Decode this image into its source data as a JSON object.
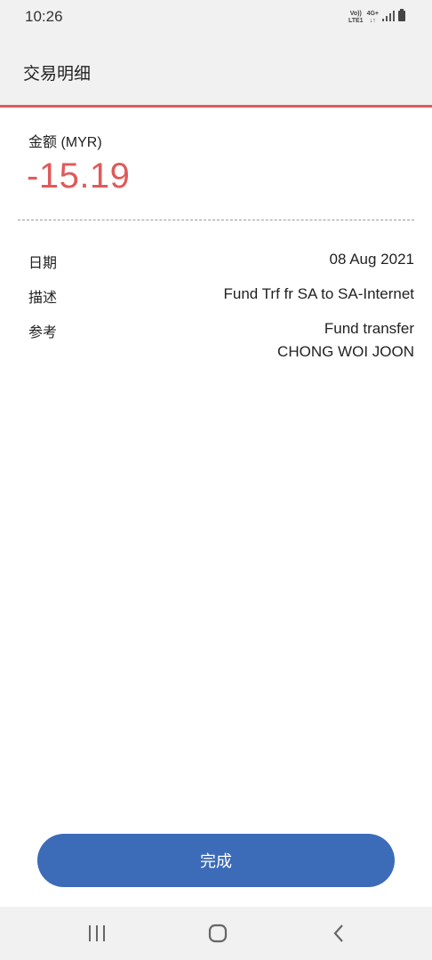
{
  "status_bar": {
    "time": "10:26",
    "volte_label_top": "Vo))",
    "volte_label_bottom": "LTE1",
    "network_label": "4G+"
  },
  "header": {
    "title": "交易明细"
  },
  "amount": {
    "label": "金额 (MYR)",
    "value": "-15.19",
    "color": "#e05a5a"
  },
  "details": {
    "date_label": "日期",
    "date_value": "08 Aug 2021",
    "description_label": "描述",
    "description_value": "Fund Trf fr SA to SA-Internet",
    "reference_label": "参考",
    "reference_line1": "Fund transfer",
    "reference_line2": "CHONG WOI JOON"
  },
  "done_button": {
    "label": "完成",
    "color": "#3c6bb8"
  },
  "nav": {
    "icons": [
      "recent-apps-icon",
      "home-icon",
      "back-icon"
    ]
  }
}
